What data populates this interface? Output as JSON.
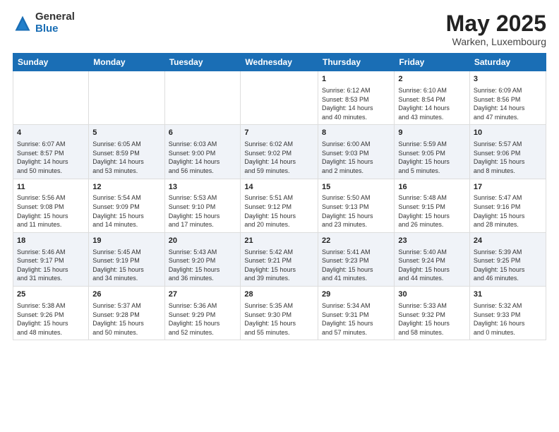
{
  "logo": {
    "general": "General",
    "blue": "Blue"
  },
  "title": "May 2025",
  "location": "Warken, Luxembourg",
  "weekdays": [
    "Sunday",
    "Monday",
    "Tuesday",
    "Wednesday",
    "Thursday",
    "Friday",
    "Saturday"
  ],
  "weeks": [
    [
      {
        "day": "",
        "info": ""
      },
      {
        "day": "",
        "info": ""
      },
      {
        "day": "",
        "info": ""
      },
      {
        "day": "",
        "info": ""
      },
      {
        "day": "1",
        "info": "Sunrise: 6:12 AM\nSunset: 8:53 PM\nDaylight: 14 hours\nand 40 minutes."
      },
      {
        "day": "2",
        "info": "Sunrise: 6:10 AM\nSunset: 8:54 PM\nDaylight: 14 hours\nand 43 minutes."
      },
      {
        "day": "3",
        "info": "Sunrise: 6:09 AM\nSunset: 8:56 PM\nDaylight: 14 hours\nand 47 minutes."
      }
    ],
    [
      {
        "day": "4",
        "info": "Sunrise: 6:07 AM\nSunset: 8:57 PM\nDaylight: 14 hours\nand 50 minutes."
      },
      {
        "day": "5",
        "info": "Sunrise: 6:05 AM\nSunset: 8:59 PM\nDaylight: 14 hours\nand 53 minutes."
      },
      {
        "day": "6",
        "info": "Sunrise: 6:03 AM\nSunset: 9:00 PM\nDaylight: 14 hours\nand 56 minutes."
      },
      {
        "day": "7",
        "info": "Sunrise: 6:02 AM\nSunset: 9:02 PM\nDaylight: 14 hours\nand 59 minutes."
      },
      {
        "day": "8",
        "info": "Sunrise: 6:00 AM\nSunset: 9:03 PM\nDaylight: 15 hours\nand 2 minutes."
      },
      {
        "day": "9",
        "info": "Sunrise: 5:59 AM\nSunset: 9:05 PM\nDaylight: 15 hours\nand 5 minutes."
      },
      {
        "day": "10",
        "info": "Sunrise: 5:57 AM\nSunset: 9:06 PM\nDaylight: 15 hours\nand 8 minutes."
      }
    ],
    [
      {
        "day": "11",
        "info": "Sunrise: 5:56 AM\nSunset: 9:08 PM\nDaylight: 15 hours\nand 11 minutes."
      },
      {
        "day": "12",
        "info": "Sunrise: 5:54 AM\nSunset: 9:09 PM\nDaylight: 15 hours\nand 14 minutes."
      },
      {
        "day": "13",
        "info": "Sunrise: 5:53 AM\nSunset: 9:10 PM\nDaylight: 15 hours\nand 17 minutes."
      },
      {
        "day": "14",
        "info": "Sunrise: 5:51 AM\nSunset: 9:12 PM\nDaylight: 15 hours\nand 20 minutes."
      },
      {
        "day": "15",
        "info": "Sunrise: 5:50 AM\nSunset: 9:13 PM\nDaylight: 15 hours\nand 23 minutes."
      },
      {
        "day": "16",
        "info": "Sunrise: 5:48 AM\nSunset: 9:15 PM\nDaylight: 15 hours\nand 26 minutes."
      },
      {
        "day": "17",
        "info": "Sunrise: 5:47 AM\nSunset: 9:16 PM\nDaylight: 15 hours\nand 28 minutes."
      }
    ],
    [
      {
        "day": "18",
        "info": "Sunrise: 5:46 AM\nSunset: 9:17 PM\nDaylight: 15 hours\nand 31 minutes."
      },
      {
        "day": "19",
        "info": "Sunrise: 5:45 AM\nSunset: 9:19 PM\nDaylight: 15 hours\nand 34 minutes."
      },
      {
        "day": "20",
        "info": "Sunrise: 5:43 AM\nSunset: 9:20 PM\nDaylight: 15 hours\nand 36 minutes."
      },
      {
        "day": "21",
        "info": "Sunrise: 5:42 AM\nSunset: 9:21 PM\nDaylight: 15 hours\nand 39 minutes."
      },
      {
        "day": "22",
        "info": "Sunrise: 5:41 AM\nSunset: 9:23 PM\nDaylight: 15 hours\nand 41 minutes."
      },
      {
        "day": "23",
        "info": "Sunrise: 5:40 AM\nSunset: 9:24 PM\nDaylight: 15 hours\nand 44 minutes."
      },
      {
        "day": "24",
        "info": "Sunrise: 5:39 AM\nSunset: 9:25 PM\nDaylight: 15 hours\nand 46 minutes."
      }
    ],
    [
      {
        "day": "25",
        "info": "Sunrise: 5:38 AM\nSunset: 9:26 PM\nDaylight: 15 hours\nand 48 minutes."
      },
      {
        "day": "26",
        "info": "Sunrise: 5:37 AM\nSunset: 9:28 PM\nDaylight: 15 hours\nand 50 minutes."
      },
      {
        "day": "27",
        "info": "Sunrise: 5:36 AM\nSunset: 9:29 PM\nDaylight: 15 hours\nand 52 minutes."
      },
      {
        "day": "28",
        "info": "Sunrise: 5:35 AM\nSunset: 9:30 PM\nDaylight: 15 hours\nand 55 minutes."
      },
      {
        "day": "29",
        "info": "Sunrise: 5:34 AM\nSunset: 9:31 PM\nDaylight: 15 hours\nand 57 minutes."
      },
      {
        "day": "30",
        "info": "Sunrise: 5:33 AM\nSunset: 9:32 PM\nDaylight: 15 hours\nand 58 minutes."
      },
      {
        "day": "31",
        "info": "Sunrise: 5:32 AM\nSunset: 9:33 PM\nDaylight: 16 hours\nand 0 minutes."
      }
    ]
  ]
}
